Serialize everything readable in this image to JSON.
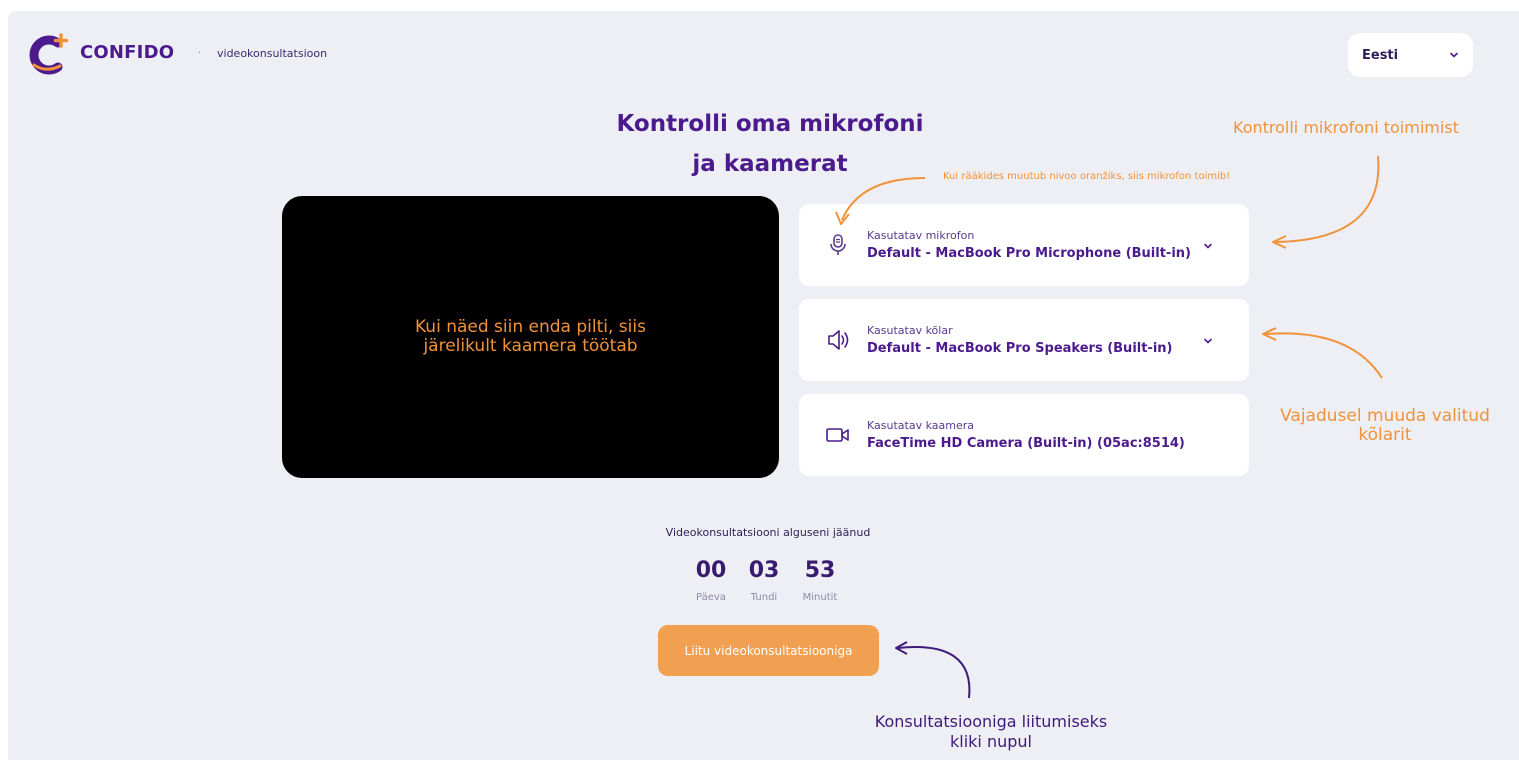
{
  "header": {
    "brand": "CONFIDO",
    "separator": "·",
    "subtitle": "videokonsultatsioon",
    "language": {
      "selected": "Eesti",
      "icon": "chevron-down-icon"
    }
  },
  "title": {
    "line1": "Kontrolli oma mikrofoni",
    "line2": "ja kaamerat"
  },
  "video": {
    "hint_line1": "Kui näed siin enda pilti, siis",
    "hint_line2": "järelikult kaamera töötab"
  },
  "devices": [
    {
      "label": "Kasutatav mikrofon",
      "value": "Default - MacBook Pro Microphone (Built-in)",
      "icon": "microphone-icon",
      "dropdown": true
    },
    {
      "label": "Kasutatav kõlar",
      "value": "Default - MacBook Pro Speakers (Built-in)",
      "icon": "speaker-icon",
      "dropdown": true
    },
    {
      "label": "Kasutatav kaamera",
      "value": "FaceTime HD Camera (Built-in) (05ac:8514)",
      "icon": "camera-icon",
      "dropdown": false
    }
  ],
  "annotations": {
    "mic_check": "Kontrolli mikrofoni toimimist",
    "mic_level": "Kui rääkides muutub nivoo oranžiks, siis mikrofon toimib!",
    "speakers_line1": "Vajadusel muuda valitud",
    "speakers_line2": "kõlarit",
    "join_line1": "Konsultatsiooniga liitumiseks",
    "join_line2": "kliki nupul"
  },
  "countdown": {
    "label": "Videokonsultatsiooni alguseni jäänud",
    "days": "00",
    "days_label": "Päeva",
    "hours": "03",
    "hours_label": "Tundi",
    "minutes": "53",
    "minutes_label": "Minutit"
  },
  "join_button": {
    "label": "Liitu videokonsultatsiooniga"
  },
  "colors": {
    "brand_purple": "#4b1a8c",
    "accent_orange": "#f0923a",
    "button_orange": "#f0a050",
    "background": "#eeeff5"
  }
}
